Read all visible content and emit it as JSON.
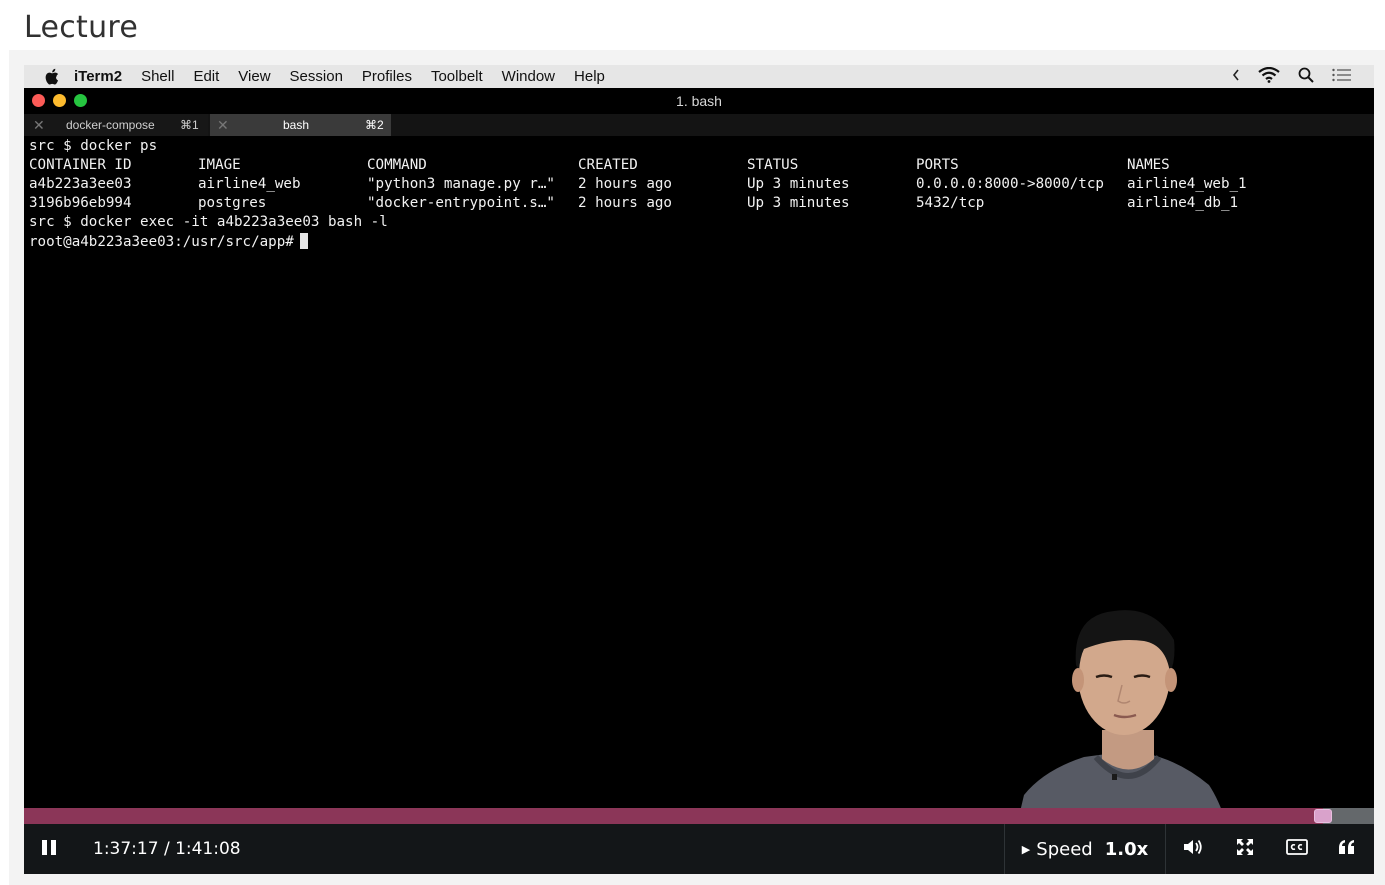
{
  "page": {
    "heading": "Lecture"
  },
  "menubar": {
    "app_name": "iTerm2",
    "items": [
      "Shell",
      "Edit",
      "View",
      "Session",
      "Profiles",
      "Toolbelt",
      "Window",
      "Help"
    ],
    "right_icons": [
      "chevron-left-icon",
      "wifi-icon",
      "search-icon",
      "list-icon"
    ]
  },
  "window": {
    "title": "1. bash"
  },
  "tabs": [
    {
      "name": "docker-compose",
      "shortcut": "⌘1",
      "active": false
    },
    {
      "name": "bash",
      "shortcut": "⌘2",
      "active": true
    }
  ],
  "terminal": {
    "cmd1": "src $ docker ps",
    "headers": [
      "CONTAINER ID",
      "IMAGE",
      "COMMAND",
      "CREATED",
      "STATUS",
      "PORTS",
      "NAMES"
    ],
    "rows": [
      [
        "a4b223a3ee03",
        "airline4_web",
        "\"python3 manage.py r…\"",
        "2 hours ago",
        "Up 3 minutes",
        "0.0.0.0:8000->8000/tcp",
        "airline4_web_1"
      ],
      [
        "3196b96eb994",
        "postgres",
        "\"docker-entrypoint.s…\"",
        "2 hours ago",
        "Up 3 minutes",
        "5432/tcp",
        "airline4_db_1"
      ]
    ],
    "cmd2": "src $ docker exec -it a4b223a3ee03 bash -l",
    "prompt": "root@a4b223a3ee03:/usr/src/app#"
  },
  "player": {
    "time": "1:37:17 / 1:41:08",
    "progress_fraction": 0.9619,
    "speed_label": "Speed",
    "speed_value": "1.0x",
    "colors": {
      "progress": "#8b3658",
      "track": "#64686b",
      "handle": "#d9a2cb",
      "controls_bg": "#131618"
    }
  }
}
